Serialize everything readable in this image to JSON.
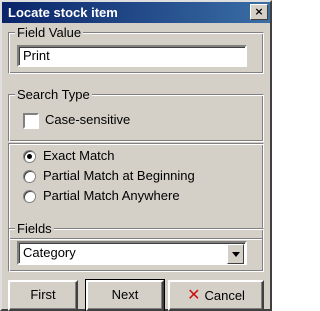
{
  "window": {
    "title": "Locate stock item",
    "close_label": "×"
  },
  "field_value": {
    "legend": "Field Value",
    "value": "Print"
  },
  "search_type": {
    "legend": "Search Type",
    "case_sensitive_label": "Case-sensitive",
    "case_sensitive_checked": false,
    "options": [
      {
        "label": "Exact Match",
        "selected": true
      },
      {
        "label": "Partial Match at Beginning",
        "selected": false
      },
      {
        "label": "Partial Match Anywhere",
        "selected": false
      }
    ]
  },
  "fields": {
    "legend": "Fields",
    "selected": "Category"
  },
  "buttons": {
    "first": "First",
    "next": "Next",
    "cancel": "Cancel"
  },
  "colors": {
    "titlebar_start": "#0a246a",
    "titlebar_end": "#3a6ea5",
    "cancel_icon": "#cc1010"
  }
}
